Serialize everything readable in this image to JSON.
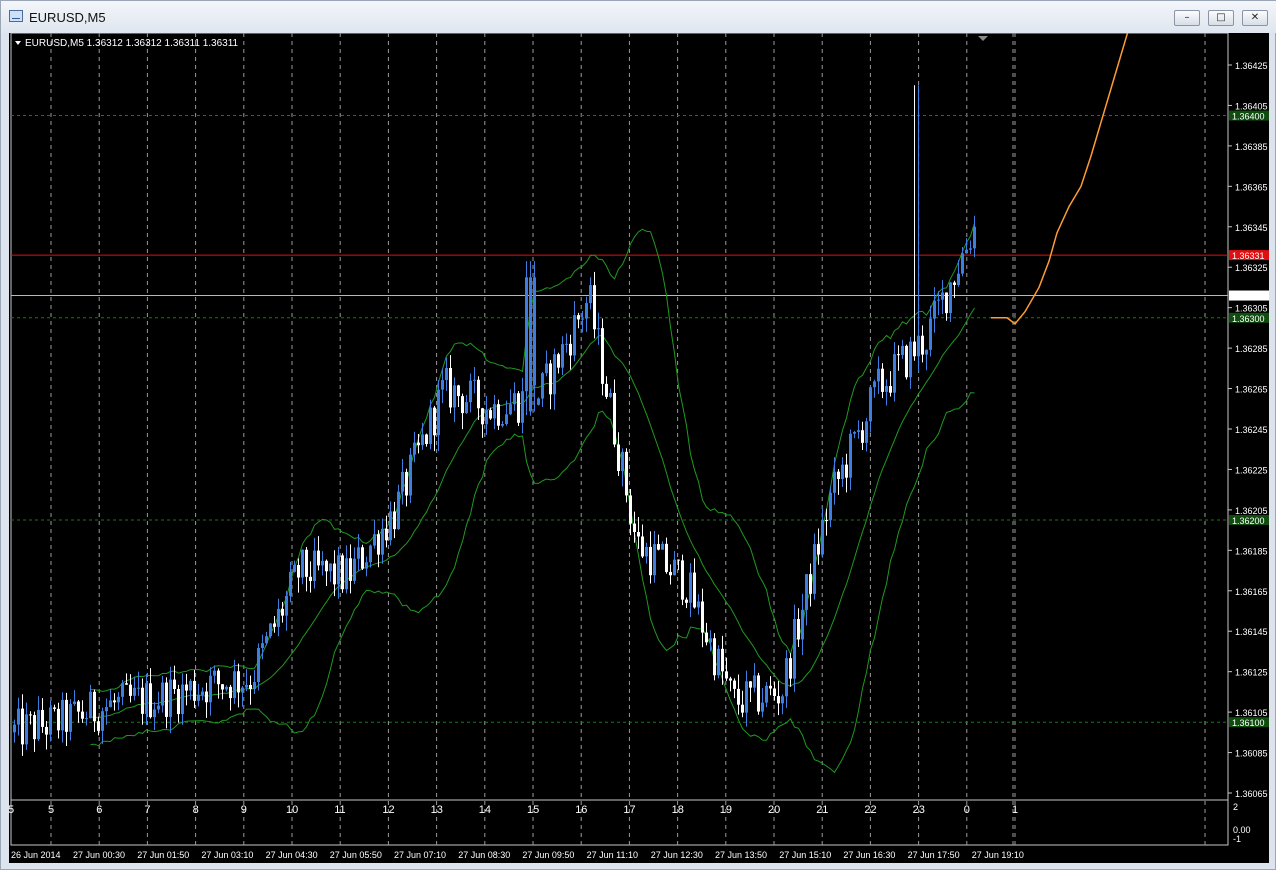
{
  "window": {
    "title": "EURUSD,M5"
  },
  "chart": {
    "info_text": "EURUSD,M5  1.36312 1.36312 1.36311 1.36311",
    "colors": {
      "background": "#000000",
      "bull": "#3d7ee0",
      "bear": "#ffffff",
      "bands": "#1f9a1f",
      "forecast": "#ff9c33",
      "resistance": "#e01010",
      "level": "#1a7a1a"
    },
    "price_ticks": [
      "1.36425",
      "1.36405",
      "1.36385",
      "1.36365",
      "1.36345",
      "1.36325",
      "1.36305",
      "1.36285",
      "1.36265",
      "1.36245",
      "1.36225",
      "1.36205",
      "1.36185",
      "1.36165",
      "1.36145",
      "1.36125",
      "1.36105",
      "1.36085",
      "1.36065"
    ],
    "price_labels": {
      "level_top": "1.36400",
      "resistance": "1.36331",
      "current": "1.36311",
      "level_mid": "1.36300",
      "level_low": "1.36200",
      "level_bottom": "1.36100"
    },
    "hours": [
      "5",
      "6",
      "7",
      "8",
      "9",
      "10",
      "11",
      "12",
      "13",
      "14",
      "15",
      "16",
      "17",
      "18",
      "19",
      "20",
      "21",
      "22",
      "23",
      "0",
      "1"
    ],
    "dates": [
      "26 Jun 2014",
      "27 Jun 00:30",
      "27 Jun 01:50",
      "27 Jun 03:10",
      "27 Jun 04:30",
      "27 Jun 05:50",
      "27 Jun 07:10",
      "27 Jun 08:30",
      "27 Jun 09:50",
      "27 Jun 11:10",
      "27 Jun 12:30",
      "27 Jun 13:50",
      "27 Jun 15:10",
      "27 Jun 16:30",
      "27 Jun 17:50",
      "27 Jun 19:10"
    ],
    "sub_ticks": [
      "2",
      "0.00",
      "-1"
    ]
  },
  "chart_data": {
    "type": "candlestick",
    "symbol": "EURUSD",
    "timeframe": "M5",
    "ylim": [
      1.36055,
      1.3644
    ],
    "last": 1.36311,
    "horizontal_levels": [
      1.364,
      1.36331,
      1.36311,
      1.363,
      1.362,
      1.361
    ],
    "closes_by_hour": [
      {
        "hour": "5",
        "close": 1.361
      },
      {
        "hour": "6",
        "close": 1.36108
      },
      {
        "hour": "7",
        "close": 1.36112
      },
      {
        "hour": "8",
        "close": 1.36118
      },
      {
        "hour": "9",
        "close": 1.36122
      },
      {
        "hour": "10",
        "close": 1.36175
      },
      {
        "hour": "11",
        "close": 1.36172
      },
      {
        "hour": "12",
        "close": 1.36205
      },
      {
        "hour": "13",
        "close": 1.36265
      },
      {
        "hour": "14",
        "close": 1.36255
      },
      {
        "hour": "15",
        "close": 1.36262
      },
      {
        "hour": "16",
        "close": 1.3631
      },
      {
        "hour": "17",
        "close": 1.36188
      },
      {
        "hour": "18",
        "close": 1.3617
      },
      {
        "hour": "19",
        "close": 1.3611
      },
      {
        "hour": "20",
        "close": 1.36115
      },
      {
        "hour": "21",
        "close": 1.3621
      },
      {
        "hour": "22",
        "close": 1.36265
      },
      {
        "hour": "23",
        "close": 1.3629
      },
      {
        "hour": "0",
        "close": 1.36345
      },
      {
        "hour": "1",
        "close": 1.363
      }
    ]
  }
}
